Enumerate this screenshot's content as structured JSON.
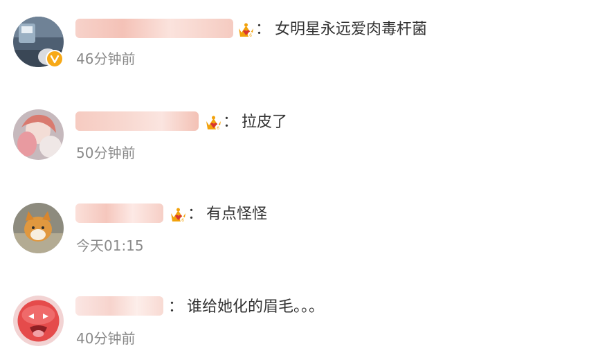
{
  "comments": [
    {
      "username": "",
      "separator": "：",
      "text": "女明星永远爱肉毒杆菌",
      "time": "46分钟前",
      "verified": true,
      "crown_icon": "vip-crown-icon"
    },
    {
      "username": "",
      "separator": "：",
      "text": "拉皮了",
      "time": "50分钟前",
      "verified": false,
      "crown_icon": "vip-crown-icon"
    },
    {
      "username": "",
      "separator": "：",
      "text": "有点怪怪",
      "time": "今天01:15",
      "verified": false,
      "crown_icon": "vip-crown-icon"
    },
    {
      "username": "",
      "separator": "：",
      "text": "谁给她化的眉毛。。。",
      "time": "40分钟前",
      "verified": false,
      "crown_icon": ""
    }
  ],
  "colors": {
    "comment_text": "#333333",
    "timestamp": "#8a8a8a",
    "verified_badge": "#f7a917",
    "username_redaction": "#f6c9bf",
    "crown": "#f2a20c"
  }
}
